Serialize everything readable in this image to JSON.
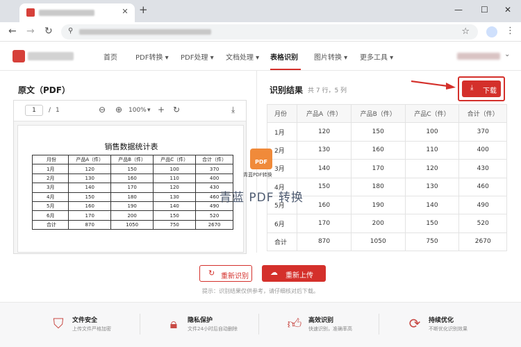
{
  "browser": {
    "new_tab": "+",
    "tab_close": "✕",
    "win_min": "—",
    "win_max": "☐",
    "win_close": "✕"
  },
  "nav": {
    "items": [
      "首页",
      "PDF转换 ▾",
      "PDF处理 ▾",
      "文档处理 ▾",
      "表格识别",
      "图片转换 ▾",
      "更多工具 ▾"
    ],
    "active": "表格识别"
  },
  "left": {
    "title": "原文（PDF）",
    "page_current": "1",
    "page_sep": "/",
    "page_total": "1",
    "zoom": "100%",
    "zoom_caret": "▾"
  },
  "pdf": {
    "title": "销售数据统计表",
    "rows": [
      [
        "月份",
        "产品A（件）",
        "产品B（件）",
        "产品C（件）",
        "合计（件）"
      ],
      [
        "1月",
        "120",
        "150",
        "100",
        "370"
      ],
      [
        "2月",
        "130",
        "160",
        "110",
        "400"
      ],
      [
        "3月",
        "140",
        "170",
        "120",
        "430"
      ],
      [
        "4月",
        "150",
        "180",
        "130",
        "460"
      ],
      [
        "5月",
        "160",
        "190",
        "140",
        "490"
      ],
      [
        "6月",
        "170",
        "200",
        "150",
        "520"
      ],
      [
        "合计",
        "870",
        "1050",
        "750",
        "2670"
      ]
    ]
  },
  "right": {
    "title": "识别结果",
    "info": "共 7 行，5 列",
    "download": "下载",
    "rows": [
      [
        "月份",
        "产品A（件）",
        "产品B（件）",
        "产品C（件）",
        "合计（件）"
      ],
      [
        "1月",
        "120",
        "150",
        "100",
        "370"
      ],
      [
        "2月",
        "130",
        "160",
        "110",
        "400"
      ],
      [
        "3月",
        "140",
        "170",
        "120",
        "430"
      ],
      [
        "4月",
        "150",
        "180",
        "130",
        "460"
      ],
      [
        "5月",
        "160",
        "190",
        "140",
        "490"
      ],
      [
        "6月",
        "170",
        "200",
        "150",
        "520"
      ],
      [
        "合计",
        "870",
        "1050",
        "750",
        "2670"
      ]
    ]
  },
  "watermark": {
    "icon_text": "PDF",
    "small": "青蓝PDF转换",
    "big": "青蓝 PDF 转换"
  },
  "actions": {
    "redo": "重新识别",
    "upload": "重新上传",
    "tip": "提示：识别结果仅供参考，请仔细核对后下载。"
  },
  "features": [
    {
      "title": "文件安全",
      "desc": "上传文件严格加密",
      "icon": "shield-check-icon"
    },
    {
      "title": "隐私保护",
      "desc": "文件24小时后自动删除",
      "icon": "lock-icon"
    },
    {
      "title": "高效识别",
      "desc": "快速识别，准确率高",
      "icon": "thumbs-up-icon"
    },
    {
      "title": "持续优化",
      "desc": "不断优化识别效果",
      "icon": "refresh-icon"
    }
  ],
  "colors": {
    "accent": "#d4302b",
    "feature_icon": "#c84a45",
    "watermark_icon": "#f08a3a"
  }
}
